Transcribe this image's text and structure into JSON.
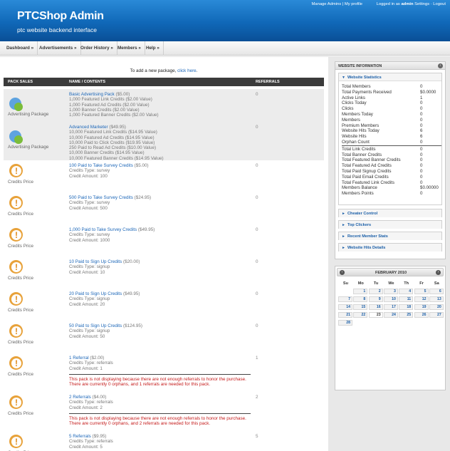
{
  "header": {
    "title": "PTCShop Admin",
    "subtitle": "ptc website backend interface",
    "manage_admins": "Manage Admins",
    "my_profile": "My profile",
    "logged_in_as": "Logged in as",
    "username": "admin",
    "settings": "Settings",
    "logout": "Logout"
  },
  "nav": [
    {
      "label": "Dashboard »"
    },
    {
      "label": "Advertisements »"
    },
    {
      "label": "Order History »"
    },
    {
      "label": "Members »"
    },
    {
      "label": "Help »"
    }
  ],
  "main": {
    "add_text": "To add a new package,",
    "add_link": "click here",
    "columns": {
      "pack_sales": "PACK SALES",
      "name": "NAME / CONTENTS",
      "referrals": "REFERRALS"
    },
    "packages": [
      {
        "type": "Advertising Package",
        "icon": "package-icon",
        "name": "Basic Advertising Pack",
        "price": "($5.00)",
        "lines": [
          "1,000 Featured Link Credits ($2.00 Value)",
          "1,000 Featured Ad Credits ($2.00 Value)",
          "1,000 Banner Credits ($2.00 Value)",
          "1,000 Featured Banner Credits ($2.00 Value)"
        ],
        "referrals": "0",
        "error": ""
      },
      {
        "type": "Advertising Package",
        "icon": "package-icon",
        "name": "Advanced Marketer",
        "price": "($49.95)",
        "lines": [
          "10,000 Featured Link Credits ($14.95 Value)",
          "10,000 Featured Ad Credits ($14.95 Value)",
          "10,000 Paid to Click Credits ($19.95 Value)",
          "250 Paid to Read Ad Credits ($10.00 Value)",
          "10,000 Banner Credits ($14.95 Value)",
          "10,000 Featured Banner Credits ($14.95 Value)"
        ],
        "referrals": "0",
        "error": ""
      },
      {
        "type": "Credits Price",
        "icon": "warning-icon",
        "name": "100 Paid to Take Survey Credits",
        "price": "($5.00)",
        "lines": [
          "Credits Type: survey",
          "Credit Amount: 100"
        ],
        "referrals": "0",
        "error": ""
      },
      {
        "type": "Credits Price",
        "icon": "warning-icon",
        "name": "500 Paid to Take Survey Credits",
        "price": "($24.95)",
        "lines": [
          "Credits Type: survey",
          "Credit Amount: 500"
        ],
        "referrals": "0",
        "error": ""
      },
      {
        "type": "Credits Price",
        "icon": "warning-icon",
        "name": "1,000 Paid to Take Survey Credits",
        "price": "($49.95)",
        "lines": [
          "Credits Type: survey",
          "Credit Amount: 1000"
        ],
        "referrals": "0",
        "error": ""
      },
      {
        "type": "Credits Price",
        "icon": "warning-icon",
        "name": "10 Paid to Sign Up Credits",
        "price": "($20.00)",
        "lines": [
          "Credits Type: signup",
          "Credit Amount: 10"
        ],
        "referrals": "0",
        "error": ""
      },
      {
        "type": "Credits Price",
        "icon": "warning-icon",
        "name": "20 Paid to Sign Up Credits",
        "price": "($49.95)",
        "lines": [
          "Credits Type: signup",
          "Credit Amount: 20"
        ],
        "referrals": "0",
        "error": ""
      },
      {
        "type": "Credits Price",
        "icon": "warning-icon",
        "name": "50 Paid to Sign Up Credits",
        "price": "($124.95)",
        "lines": [
          "Credits Type: signup",
          "Credit Amount: 50"
        ],
        "referrals": "0",
        "error": ""
      },
      {
        "type": "Credits Price",
        "icon": "warning-icon",
        "name": "1 Referral",
        "price": "($2.00)",
        "lines": [
          "Credits Type: referrals",
          "Credit Amount: 1"
        ],
        "referrals": "1",
        "error": "This pack is not displaying because there are not enough referrals to honor the purchase. There are currently 0 orphans, and 1 referrals are needed for this pack."
      },
      {
        "type": "Credits Price",
        "icon": "warning-icon",
        "name": "2 Referrals",
        "price": "($4.00)",
        "lines": [
          "Credits Type: referrals",
          "Credit Amount: 2"
        ],
        "referrals": "2",
        "error": "This pack is not displaying because there are not enough referrals to honor the purchase. There are currently 0 orphans, and 2 referrals are needed for this pack."
      },
      {
        "type": "Credits Price",
        "icon": "warning-icon",
        "name": "5 Referrals",
        "price": "($9.95)",
        "lines": [
          "Credits Type: referrals",
          "Credit Amount: 5"
        ],
        "referrals": "5",
        "error": ""
      }
    ]
  },
  "sidebar": {
    "panel_title": "WEBSITE INFORMATION",
    "stats_title": "Website Statistics",
    "stats": [
      {
        "label": "Total Members",
        "value": "0"
      },
      {
        "label": "Total Payments Received",
        "value": "$0.0000"
      },
      {
        "label": "Active Links",
        "value": "1"
      },
      {
        "label": "Clicks Today",
        "value": "0"
      },
      {
        "label": "Clicks",
        "value": "0"
      },
      {
        "label": "Members Today",
        "value": "0"
      },
      {
        "label": "Members",
        "value": "0"
      },
      {
        "label": "Premium Members",
        "value": "0"
      },
      {
        "label": "Website Hits Today",
        "value": "6"
      },
      {
        "label": "Website Hits",
        "value": "6"
      },
      {
        "label": "Orphan Count",
        "value": "0"
      }
    ],
    "stats2": [
      {
        "label": "Total Link Credits",
        "value": "0"
      },
      {
        "label": "Total Banner Credits",
        "value": "0"
      },
      {
        "label": "Total Featured Banner Credits",
        "value": "0"
      },
      {
        "label": "Total Featured Ad Credits",
        "value": "0"
      },
      {
        "label": "Total Paid Signup Credits",
        "value": "0"
      },
      {
        "label": "Total Paid Email Credits",
        "value": "0"
      },
      {
        "label": "Total Featured Link Credits",
        "value": "0"
      },
      {
        "label": "Members Balance",
        "value": "$0.00000"
      },
      {
        "label": "Members Points",
        "value": "0"
      }
    ],
    "boxes": [
      {
        "label": "Cheater Control"
      },
      {
        "label": "Top Clickers"
      },
      {
        "label": "Recent Member Stats"
      },
      {
        "label": "Website Hits Details"
      }
    ],
    "calendar": {
      "month": "FEBRUARY 2010",
      "days": [
        "Su",
        "Mo",
        "Tu",
        "We",
        "Th",
        "Fr",
        "Sa"
      ],
      "weeks": [
        [
          "",
          "1",
          "2",
          "3",
          "4",
          "5",
          "6"
        ],
        [
          "7",
          "8",
          "9",
          "10",
          "11",
          "12",
          "13"
        ],
        [
          "14",
          "15",
          "16",
          "17",
          "18",
          "19",
          "20"
        ],
        [
          "21",
          "22",
          "23",
          "24",
          "25",
          "26",
          "27"
        ],
        [
          "28",
          "",
          "",
          "",
          "",
          "",
          ""
        ]
      ],
      "today": "23"
    }
  }
}
